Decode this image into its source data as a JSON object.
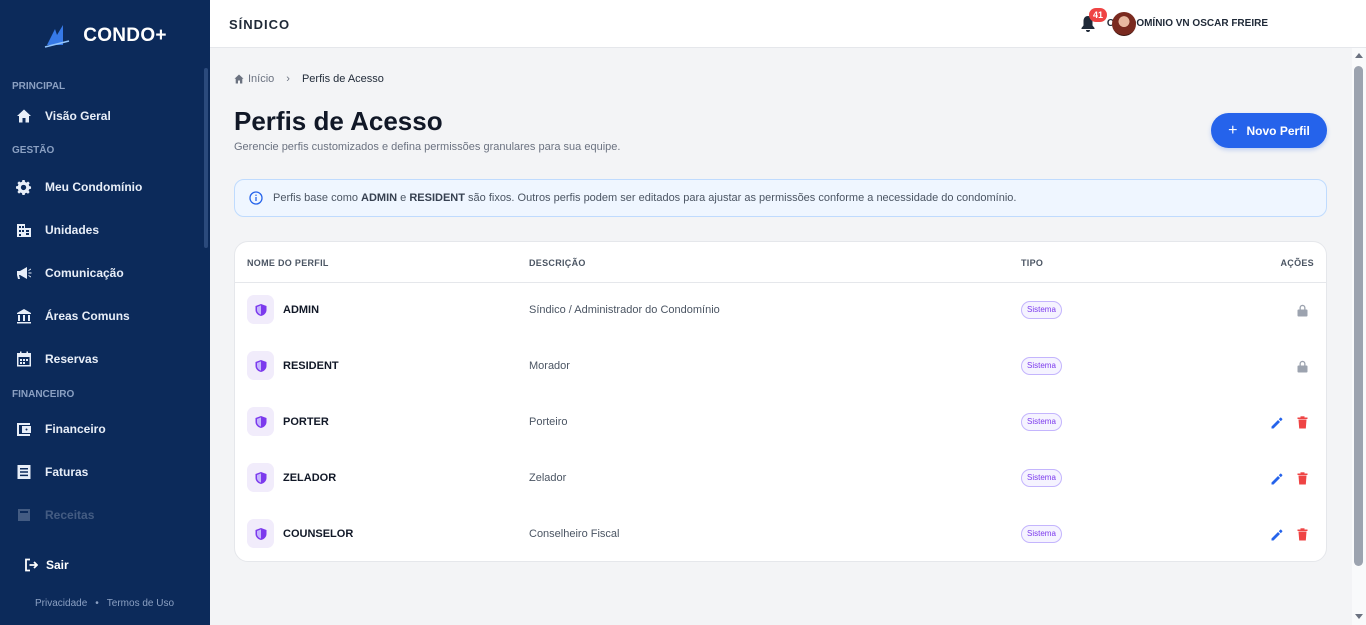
{
  "sidebar": {
    "brand": "CONDO+",
    "sections": [
      {
        "label": "PRINCIPAL",
        "items": [
          {
            "label": "Visão Geral",
            "icon": "home-icon"
          }
        ]
      },
      {
        "label": "GESTÃO",
        "items": [
          {
            "label": "Meu Condomínio",
            "icon": "gear-icon"
          },
          {
            "label": "Unidades",
            "icon": "building-icon"
          },
          {
            "label": "Comunicação",
            "icon": "megaphone-icon"
          },
          {
            "label": "Áreas Comuns",
            "icon": "bank-icon"
          },
          {
            "label": "Reservas",
            "icon": "calendar-icon"
          }
        ]
      },
      {
        "label": "FINANCEIRO",
        "items": [
          {
            "label": "Financeiro",
            "icon": "wallet-icon"
          },
          {
            "label": "Faturas",
            "icon": "invoice-icon"
          },
          {
            "label": "Receitas",
            "icon": "receipt-icon"
          }
        ]
      }
    ],
    "logout": "Sair",
    "legal": {
      "privacy": "Privacidade",
      "dot": "•",
      "terms": "Termos de Uso"
    }
  },
  "header": {
    "title": "SÍNDICO",
    "condo": "CONDOMÍNIO VN OSCAR FREIRE",
    "notifications": "41"
  },
  "breadcrumb": {
    "home": "Início",
    "sep": "›",
    "current": "Perfis de Acesso"
  },
  "page": {
    "title": "Perfis de Acesso",
    "subtitle": "Gerencie perfis customizados e defina permissões granulares para sua equipe.",
    "new_button": "Novo Perfil",
    "info": {
      "prefix": "Perfis base como ",
      "b1": "ADMIN",
      "mid": " e ",
      "b2": "RESIDENT",
      "suffix": " são fixos. Outros perfis podem ser editados para ajustar as permissões conforme a necessidade do condomínio."
    }
  },
  "table": {
    "headers": {
      "name": "NOME DO PERFIL",
      "description": "DESCRIÇÃO",
      "type": "TIPO",
      "actions": "AÇÕES"
    },
    "rows": [
      {
        "name": "ADMIN",
        "description": "Síndico / Administrador do Condomínio",
        "type": "Sistema",
        "locked": true
      },
      {
        "name": "RESIDENT",
        "description": "Morador",
        "type": "Sistema",
        "locked": true
      },
      {
        "name": "PORTER",
        "description": "Porteiro",
        "type": "Sistema",
        "locked": false
      },
      {
        "name": "ZELADOR",
        "description": "Zelador",
        "type": "Sistema",
        "locked": false
      },
      {
        "name": "COUNSELOR",
        "description": "Conselheiro Fiscal",
        "type": "Sistema",
        "locked": false
      }
    ]
  },
  "colors": {
    "sidebar": "#0c2a5a",
    "primary": "#2563eb",
    "tag": "#7c3aed",
    "danger": "#ef4444"
  }
}
